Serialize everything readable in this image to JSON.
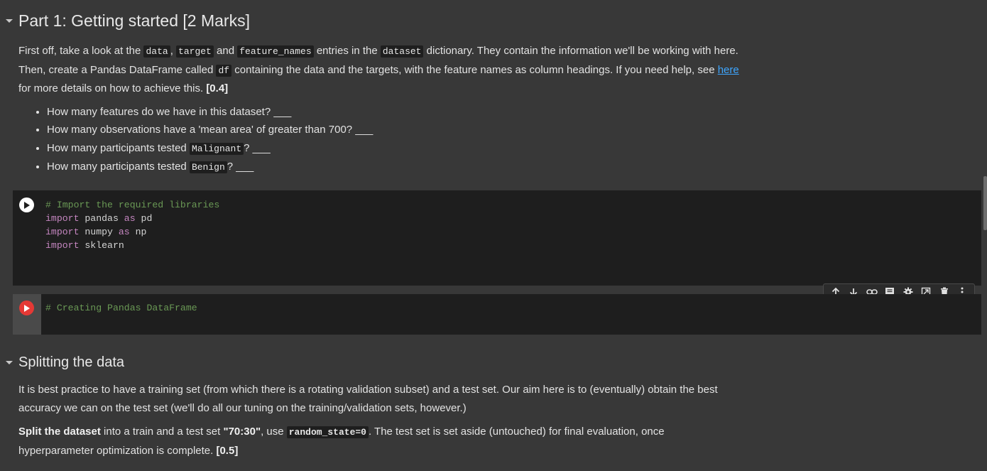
{
  "section1": {
    "title": "Part 1: Getting started [2 Marks]",
    "para": {
      "t1": "First off, take a look at the ",
      "c1": "data",
      "t2": ", ",
      "c2": "target",
      "t3": " and ",
      "c3": "feature_names",
      "t4": " entries in the ",
      "c4": "dataset",
      "t5": " dictionary. They contain the information we'll be working with here. Then, create a Pandas DataFrame called ",
      "c5": "df",
      "t6": " containing the data and the targets, with the feature names as column headings. If you need help, see ",
      "link": "here",
      "t7": " for more details on how to achieve this. ",
      "marks": "[0.4]"
    },
    "bullets": [
      {
        "text": "How many features do we have in this dataset? ___"
      },
      {
        "text": "How many observations have a 'mean area' of greater than 700? ___"
      },
      {
        "pre": "How many participants tested ",
        "code": "Malignant",
        "post": "? ___"
      },
      {
        "pre": "How many participants tested ",
        "code": "Benign",
        "post": "? ___"
      }
    ]
  },
  "cell1": {
    "comment": "# Import the required libraries",
    "lines": [
      {
        "kw": "import",
        "a": " pandas ",
        "kw2": "as",
        "b": " pd"
      },
      {
        "kw": "import",
        "a": " numpy ",
        "kw2": "as",
        "b": " np"
      },
      {
        "kw": "import",
        "a": " sklearn",
        "kw2": "",
        "b": ""
      }
    ]
  },
  "cell2": {
    "comment": "# Creating Pandas DataFrame"
  },
  "toolbar": {
    "icons": [
      "arrow-up-icon",
      "arrow-down-icon",
      "link-icon",
      "comment-icon",
      "gear-icon",
      "mirror-cell-icon",
      "delete-icon",
      "more-vert-icon"
    ]
  },
  "section2": {
    "title": "Splitting the data",
    "para1": "It is best practice to have a training set (from which there is a rotating validation subset) and a test set. Our aim here is to (eventually) obtain the best accuracy we can on the test set (we'll do all our tuning on the training/validation sets, however.)",
    "para2": {
      "bold1": "Split the dataset",
      "t1": " into a train and a test set ",
      "bold2": "\"70:30\"",
      "t2": ", use ",
      "code": "random_state=0",
      "t3": ". The test set is set aside (untouched) for final evaluation, once hyperparameter optimization is complete. ",
      "marks": "[0.5]"
    }
  },
  "colors": {
    "background": "#383838",
    "cell_bg": "#1e1e1e",
    "run_active": "#e53935",
    "comment": "#6a9955",
    "keyword": "#c586c0",
    "link": "#3ea6ff"
  }
}
